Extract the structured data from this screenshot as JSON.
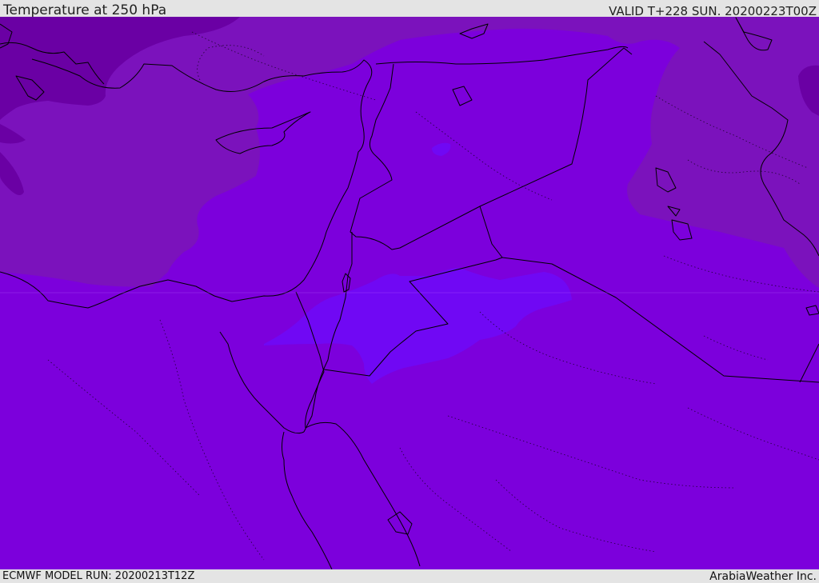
{
  "header": {
    "title": "Temperature at 250 hPa",
    "valid": "VALID T+228 SUN. 20200223T00Z"
  },
  "footer": {
    "model_run": "ECMWF MODEL RUN: 20200213T12Z",
    "credit": "ArabiaWeather Inc."
  },
  "map": {
    "colors": {
      "base": "#7c00dc",
      "cooler": "#7b12bc",
      "coldest": "#6a00a4",
      "warm_patch": "#7008f4",
      "warmest": "#7700ff",
      "coastline": "#000000"
    }
  }
}
